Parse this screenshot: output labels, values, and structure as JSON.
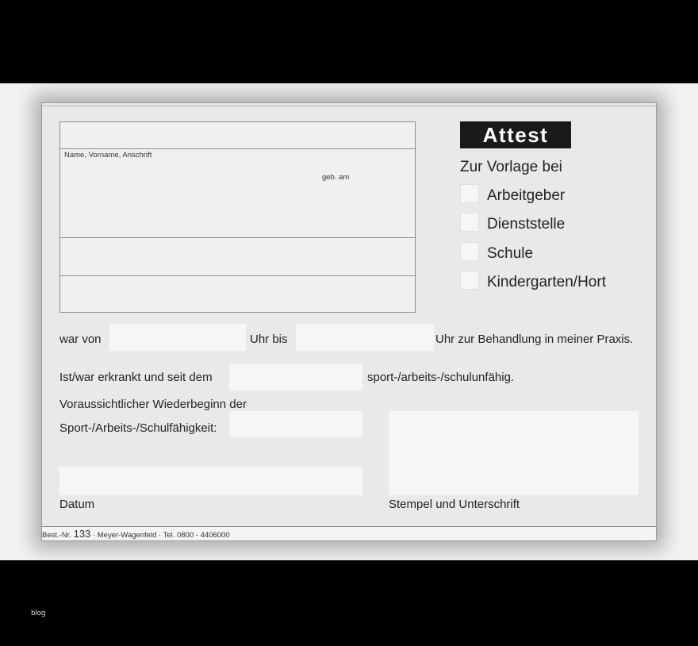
{
  "form": {
    "title": "Attest",
    "address_label": "Name, Vorname, Anschrift",
    "birth_label": "geb. am",
    "presentation_heading": "Zur Vorlage bei",
    "options": [
      {
        "label": "Arbeitgeber"
      },
      {
        "label": "Dienststelle"
      },
      {
        "label": "Schule"
      },
      {
        "label": "Kindergarten/Hort"
      }
    ],
    "visit": {
      "prefix": "war von",
      "middle": "Uhr bis",
      "suffix": "Uhr zur Behandlung in meiner Praxis."
    },
    "ill": {
      "prefix": "Ist/war erkrankt und seit dem",
      "suffix": "sport-/arbeits-/schulunfähig."
    },
    "resume": {
      "line1": "Voraussichtlicher Wiederbeginn der",
      "line2": "Sport-/Arbeits-/Schulfähigkeit:"
    },
    "date_label": "Datum",
    "stamp_label": "Stempel und Unterschrift"
  },
  "footer": {
    "prefix": "Best.-Nr.",
    "number": "133",
    "rest": "· Meyer-Wagenfeld · Tel. 0800 - 4406000"
  },
  "watermark": "blog"
}
